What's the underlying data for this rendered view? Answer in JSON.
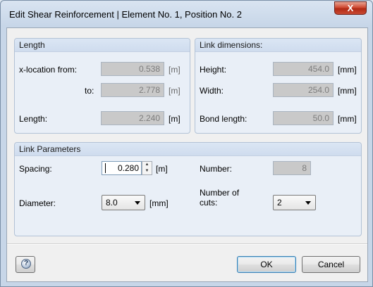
{
  "window": {
    "title": "Edit Shear Reinforcement | Element No. 1, Position No. 2",
    "close_label": "X"
  },
  "length_group": {
    "title": "Length",
    "x_from_label": "x-location from:",
    "x_from_value": "0.538",
    "x_from_unit": "[m]",
    "to_label": "to:",
    "to_value": "2.778",
    "to_unit": "[m]",
    "length_label": "Length:",
    "length_value": "2.240",
    "length_unit": "[m]"
  },
  "link_dimensions": {
    "title": "Link dimensions:",
    "height_label": "Height:",
    "height_value": "454.0",
    "height_unit": "[mm]",
    "width_label": "Width:",
    "width_value": "254.0",
    "width_unit": "[mm]",
    "bond_label": "Bond length:",
    "bond_value": "50.0",
    "bond_unit": "[mm]"
  },
  "link_parameters": {
    "title": "Link Parameters",
    "spacing_label": "Spacing:",
    "spacing_value": "0.280",
    "spacing_unit": "[m]",
    "number_label": "Number:",
    "number_value": "8",
    "diameter_label": "Diameter:",
    "diameter_value": "8.0",
    "diameter_unit": "[mm]",
    "cuts_label_line1": "Number of",
    "cuts_label_line2": "cuts:",
    "cuts_value": "2"
  },
  "buttons": {
    "ok": "OK",
    "cancel": "Cancel",
    "help_symbol": "?"
  }
}
